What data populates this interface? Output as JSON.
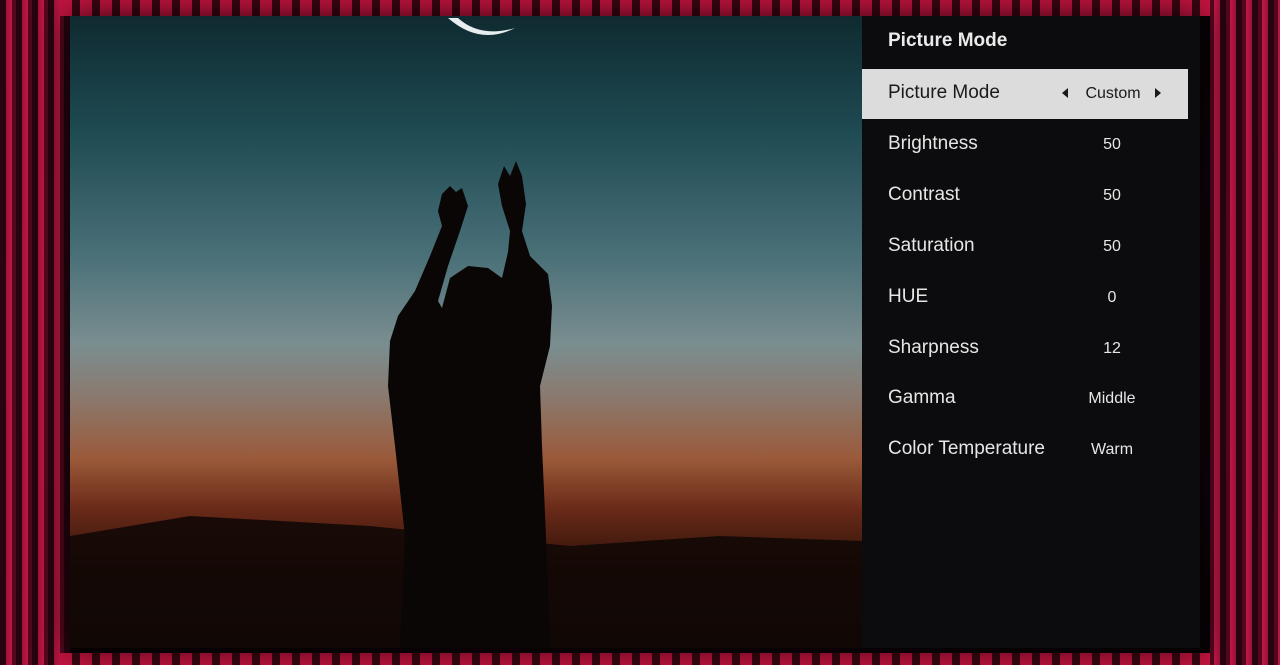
{
  "menu": {
    "title": "Picture Mode",
    "items": [
      {
        "label": "Picture Mode",
        "value": "Custom",
        "selected": true
      },
      {
        "label": "Brightness",
        "value": "50"
      },
      {
        "label": "Contrast",
        "value": "50"
      },
      {
        "label": "Saturation",
        "value": "50"
      },
      {
        "label": "HUE",
        "value": "0"
      },
      {
        "label": "Sharpness",
        "value": "12"
      },
      {
        "label": "Gamma",
        "value": "Middle"
      },
      {
        "label": "Color Temperature",
        "value": "Warm"
      }
    ]
  },
  "icons": {
    "prev": "arrow-left-icon",
    "next": "arrow-right-icon"
  },
  "colors": {
    "ambient_red": "#c41440",
    "menu_bg": "#0c0c0e",
    "highlight_bg": "#dcdcdc"
  }
}
